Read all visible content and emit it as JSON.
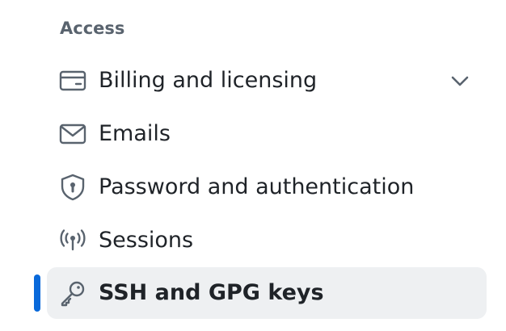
{
  "sidebar": {
    "section_heading": "Access",
    "accent_color": "#0969da",
    "items": [
      {
        "label": "Billing and licensing",
        "icon": "credit-card-icon",
        "has_chevron": true,
        "selected": false
      },
      {
        "label": "Emails",
        "icon": "mail-icon",
        "has_chevron": false,
        "selected": false
      },
      {
        "label": "Password and authentication",
        "icon": "shield-lock-icon",
        "has_chevron": false,
        "selected": false
      },
      {
        "label": "Sessions",
        "icon": "broadcast-icon",
        "has_chevron": false,
        "selected": false
      },
      {
        "label": "SSH and GPG keys",
        "icon": "key-icon",
        "has_chevron": false,
        "selected": true
      }
    ]
  }
}
